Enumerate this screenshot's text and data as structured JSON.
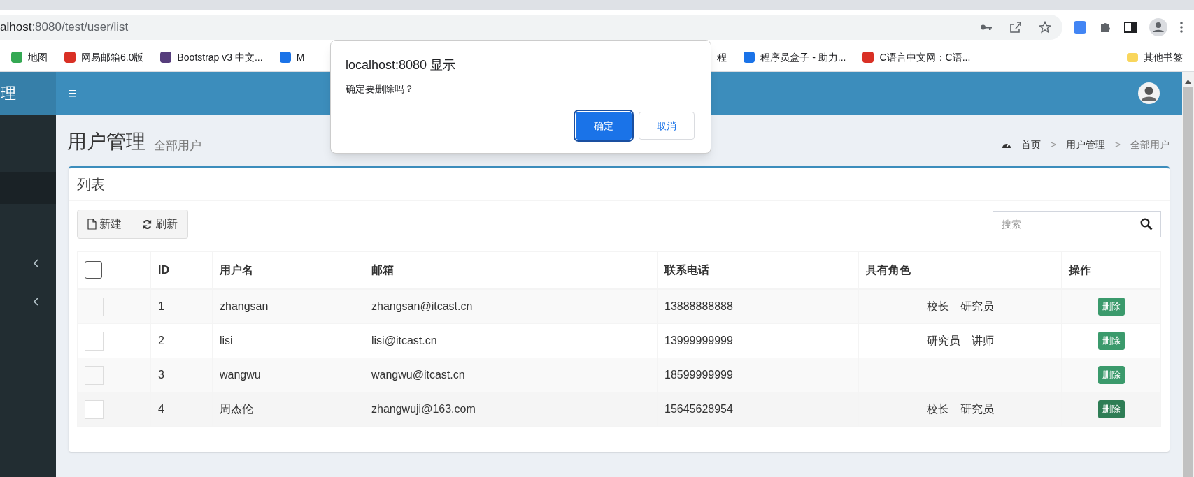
{
  "browser": {
    "address": {
      "host": "alhost",
      "path": ":8080/test/user/list"
    },
    "bookmarks": [
      {
        "label": "地图",
        "color": "#34a853"
      },
      {
        "label": "网易邮箱6.0版",
        "color": "#d93025"
      },
      {
        "label": "Bootstrap v3 中文...",
        "color": "#563d7c"
      },
      {
        "label": "M",
        "color": "#1a73e8"
      },
      {
        "label": "程"
      },
      {
        "label": "程序员盒子 - 助力...",
        "color": "#1a73e8"
      },
      {
        "label": "C语言中文网：C语...",
        "color": "#d93025"
      }
    ],
    "other_bookmarks": "其他书签"
  },
  "header": {
    "logo_text": "理",
    "menu_glyph": "≡"
  },
  "sidebar": {
    "items": [
      {
        "selected": true,
        "expandable": false
      },
      {
        "selected": false,
        "expandable": true
      },
      {
        "selected": false,
        "expandable": true
      }
    ]
  },
  "page": {
    "title": "用户管理",
    "subtitle": "全部用户",
    "breadcrumb": [
      {
        "label": "首页"
      },
      {
        "label": "用户管理"
      },
      {
        "label": "全部用户"
      }
    ],
    "breadcrumb_separator": ">"
  },
  "box": {
    "title": "列表",
    "buttons": [
      {
        "label": "新建",
        "kind": "new"
      },
      {
        "label": "刷新",
        "kind": "refresh"
      }
    ],
    "search": {
      "placeholder": "搜索"
    }
  },
  "table": {
    "columns": [
      "ID",
      "用户名",
      "邮箱",
      "联系电话",
      "具有角色",
      "操作"
    ],
    "select_all_checked": false,
    "rows": [
      {
        "checked": false,
        "hovered": false,
        "id": "1",
        "username": "zhangsan",
        "email": "zhangsan@itcast.cn",
        "phone": "13888888888",
        "roles": [
          "校长",
          "研究员"
        ],
        "action": "删除"
      },
      {
        "checked": false,
        "hovered": false,
        "id": "2",
        "username": "lisi",
        "email": "lisi@itcast.cn",
        "phone": "13999999999",
        "roles": [
          "研究员",
          "讲师"
        ],
        "action": "删除"
      },
      {
        "checked": false,
        "hovered": false,
        "id": "3",
        "username": "wangwu",
        "email": "wangwu@itcast.cn",
        "phone": "18599999999",
        "action": "删除"
      },
      {
        "checked": false,
        "hovered": true,
        "id": "4",
        "username": "周杰伦",
        "email": "zhangwuji@163.com",
        "phone": "15645628954",
        "roles": [
          "校长",
          "研究员"
        ],
        "action": "删除"
      }
    ]
  },
  "dialog": {
    "title": "localhost:8080 显示",
    "message": "确定要删除吗？",
    "buttons": [
      {
        "label": "确定",
        "kind": "primary"
      },
      {
        "label": "取消",
        "kind": "secondary"
      }
    ]
  }
}
